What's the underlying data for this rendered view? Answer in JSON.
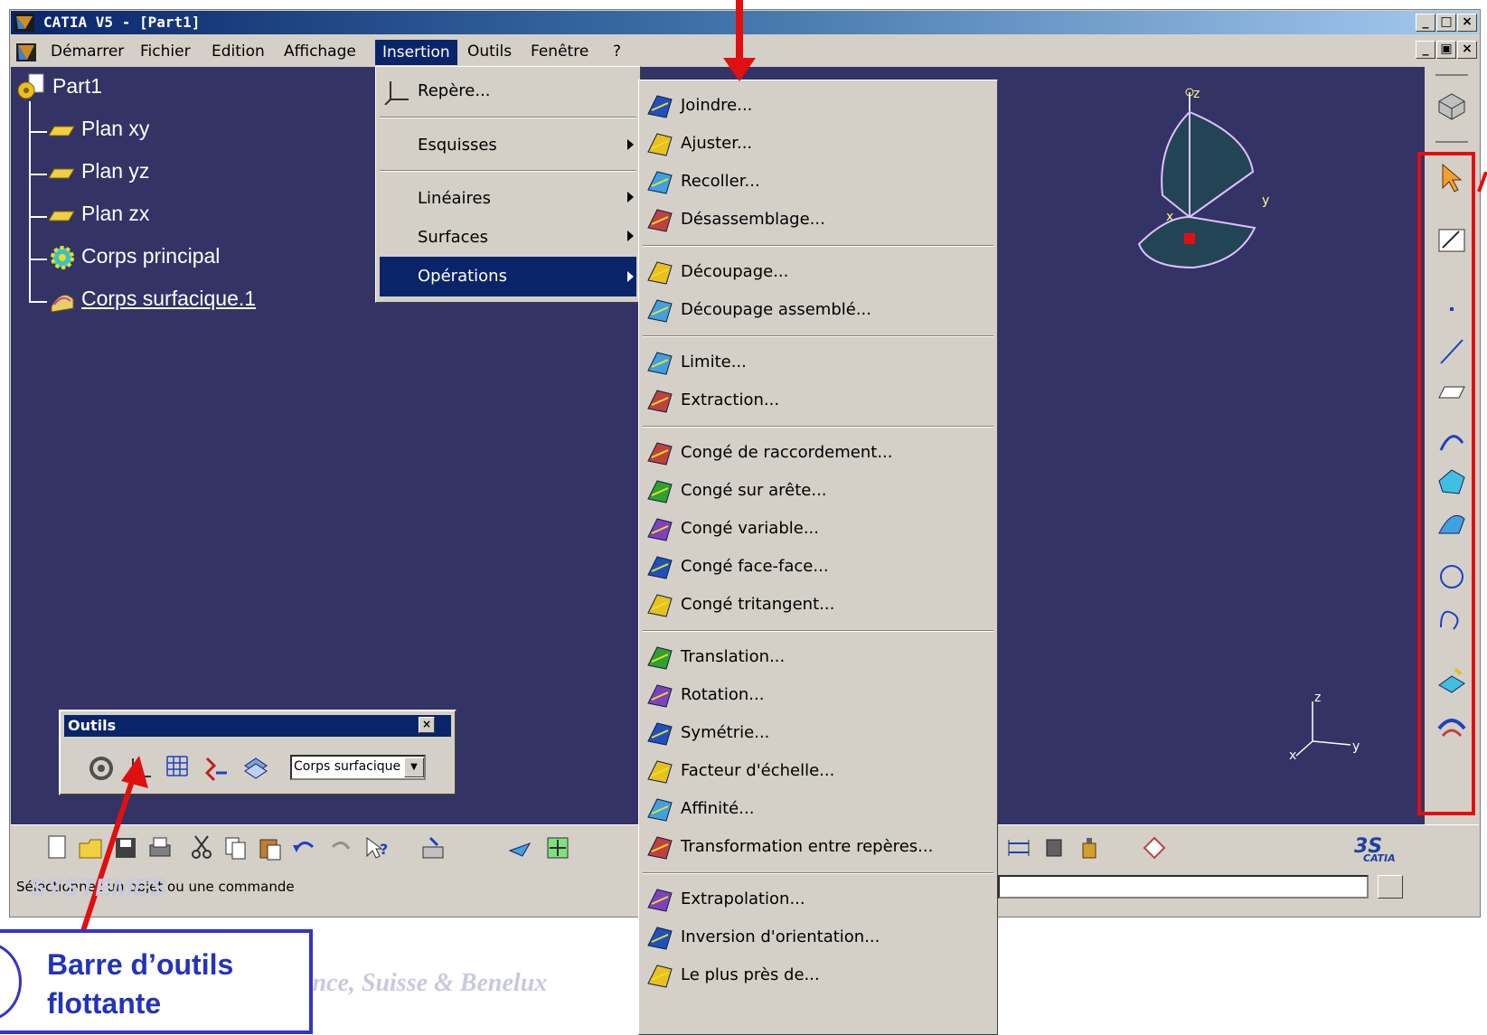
{
  "window": {
    "title": "CATIA V5 - [Part1]",
    "controls": [
      "_",
      "□",
      "×"
    ],
    "doc_controls": [
      "_",
      "▣",
      "×"
    ]
  },
  "menubar": {
    "items": [
      "Démarrer",
      "Fichier",
      "Edition",
      "Affichage",
      "Insertion",
      "Outils",
      "Fenêtre",
      "?"
    ],
    "active": "Insertion"
  },
  "tree": {
    "root": "Part1",
    "items": [
      "Plan xy",
      "Plan yz",
      "Plan zx",
      "Corps principal",
      "Corps surfacique.1"
    ]
  },
  "insertion_menu": {
    "items": [
      {
        "label": "Repère...",
        "submenu": false
      },
      {
        "label": "Esquisses",
        "submenu": true
      },
      {
        "label": "Linéaires",
        "submenu": true
      },
      {
        "label": "Surfaces",
        "submenu": true
      },
      {
        "label": "Opérations",
        "submenu": true,
        "highlighted": true
      }
    ]
  },
  "operations_menu": {
    "groups": [
      [
        "Joindre...",
        "Ajuster...",
        "Recoller...",
        "Désassemblage..."
      ],
      [
        "Découpage...",
        "Découpage assemblé..."
      ],
      [
        "Limite...",
        "Extraction..."
      ],
      [
        "Congé de raccordement...",
        "Congé sur arête...",
        "Congé variable...",
        "Congé face-face...",
        "Congé tritangent..."
      ],
      [
        "Translation...",
        "Rotation...",
        "Symétrie...",
        "Facteur d'échelle...",
        "Affinité...",
        "Transformation entre repères..."
      ],
      [
        "Extrapolation...",
        "Inversion d'orientation...",
        "Le plus près de..."
      ]
    ]
  },
  "floating_toolbar": {
    "title": "Outils",
    "close": "×",
    "select_value": "Corps surfacique"
  },
  "status_bar": {
    "text": "Sélectionnez un objet ou une commande"
  },
  "axis_labels": {
    "z": "z",
    "y": "y",
    "x": "x",
    "compass_z": "z",
    "compass_y": "y",
    "compass_x": "x"
  },
  "logo": {
    "text": "CATIA"
  },
  "annotation": {
    "line1": "Barre d’outils",
    "line2": "flottante"
  },
  "footer": {
    "watermark_top": "SYSTEMES",
    "watermark_bottom": "Direction des Ventes France, Suisse & Benelux"
  },
  "colors": {
    "viewport_bg": "#333366",
    "menu_highlight": "#0a246a",
    "annotation_red": "#e01010",
    "annotation_blue": "#3333cc"
  }
}
